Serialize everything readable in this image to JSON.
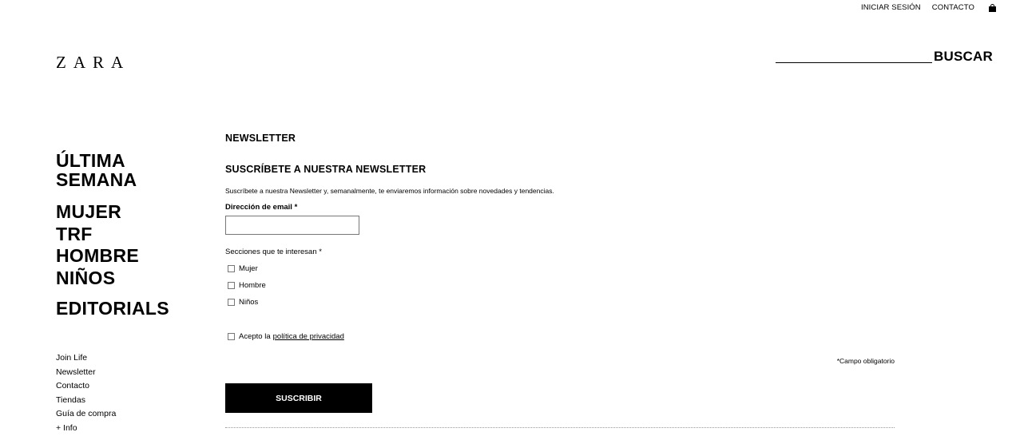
{
  "header": {
    "login_label": "INICIAR SESIÓN",
    "contact_label": "CONTACTO",
    "cart_icon": "shopping-bag-icon",
    "logo": "ZARA",
    "search_placeholder": "",
    "search_button": "BUSCAR"
  },
  "main_nav": [
    "ÚLTIMA",
    "SEMANA",
    "MUJER",
    "TRF",
    "HOMBRE",
    "NIÑOS",
    "EDITORIALS"
  ],
  "footer_nav": [
    "Join Life",
    "Newsletter",
    "Contacto",
    "Tiendas",
    "Guía de compra",
    "+ Info"
  ],
  "newsletter": {
    "page_title": "NEWSLETTER",
    "subtitle": "SUSCRÍBETE A NUESTRA NEWSLETTER",
    "description": "Suscríbete a nuestra Newsletter y, semanalmente, te enviaremos información sobre novedades y tendencias.",
    "email_label": "Dirección de email *",
    "email_value": "",
    "sections_label": "Secciones que te interesan *",
    "sections": [
      "Mujer",
      "Hombre",
      "Niños"
    ],
    "privacy_prefix": "Acepto la",
    "privacy_link": "política de privacidad",
    "required_note": "*Campo obligatorio",
    "submit_label": "SUSCRIBIR"
  }
}
